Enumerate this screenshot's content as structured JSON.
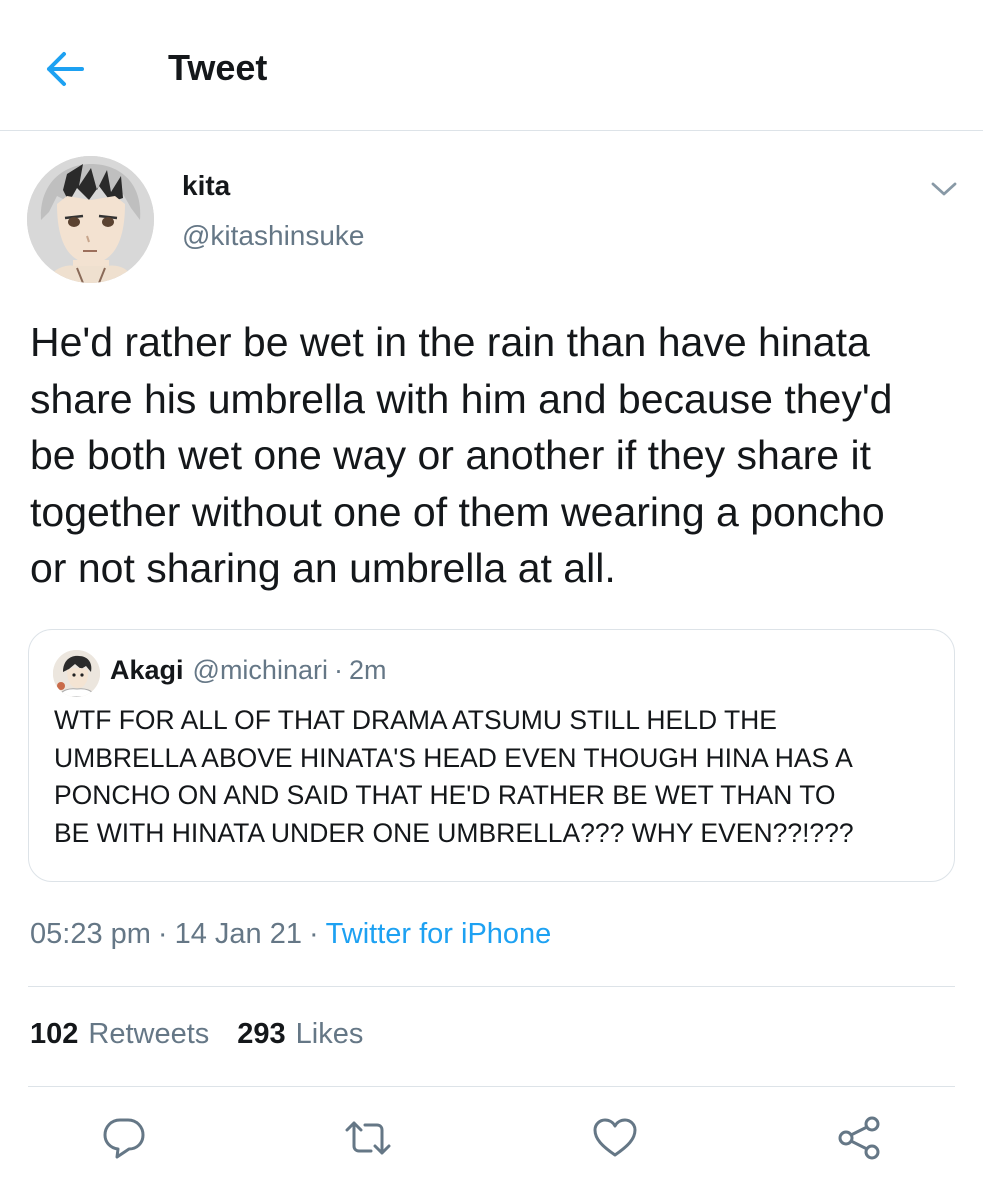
{
  "header": {
    "title": "Tweet"
  },
  "author": {
    "name": "kita",
    "handle": "@kitashinsuke"
  },
  "tweet": {
    "text_lines": [
      "He'd rather be wet in the rain than have hinata",
      "share his umbrella with him and because they'd",
      "be both wet one way or another if they share it",
      "together without one of them wearing a poncho",
      "or not sharing an umbrella at all."
    ]
  },
  "quoted": {
    "name": "Akagi",
    "handle": "@michinari",
    "separator": "·",
    "time": "2m",
    "text_lines": [
      "WTF FOR ALL OF THAT DRAMA ATSUMU STILL HELD THE",
      "UMBRELLA ABOVE HINATA'S HEAD EVEN THOUGH HINA HAS A",
      "PONCHO ON AND SAID THAT HE'D RATHER BE WET THAN TO",
      "BE WITH HINATA UNDER ONE UMBRELLA??? WHY EVEN??!???"
    ]
  },
  "meta": {
    "time": "05:23 pm",
    "separator": "·",
    "date": "14 Jan 21",
    "source": "Twitter for iPhone"
  },
  "stats": {
    "retweets_count": "102",
    "retweets_label": "Retweets",
    "likes_count": "293",
    "likes_label": "Likes"
  },
  "icons": {
    "back": "arrow-left-icon",
    "caret": "chevron-down-icon",
    "reply": "reply-icon",
    "retweet": "retweet-icon",
    "like": "heart-icon",
    "share": "share-icon"
  },
  "colors": {
    "accent": "#1da1f2",
    "text_primary": "#14171a",
    "text_secondary": "#657786",
    "border": "#dde3e8"
  }
}
